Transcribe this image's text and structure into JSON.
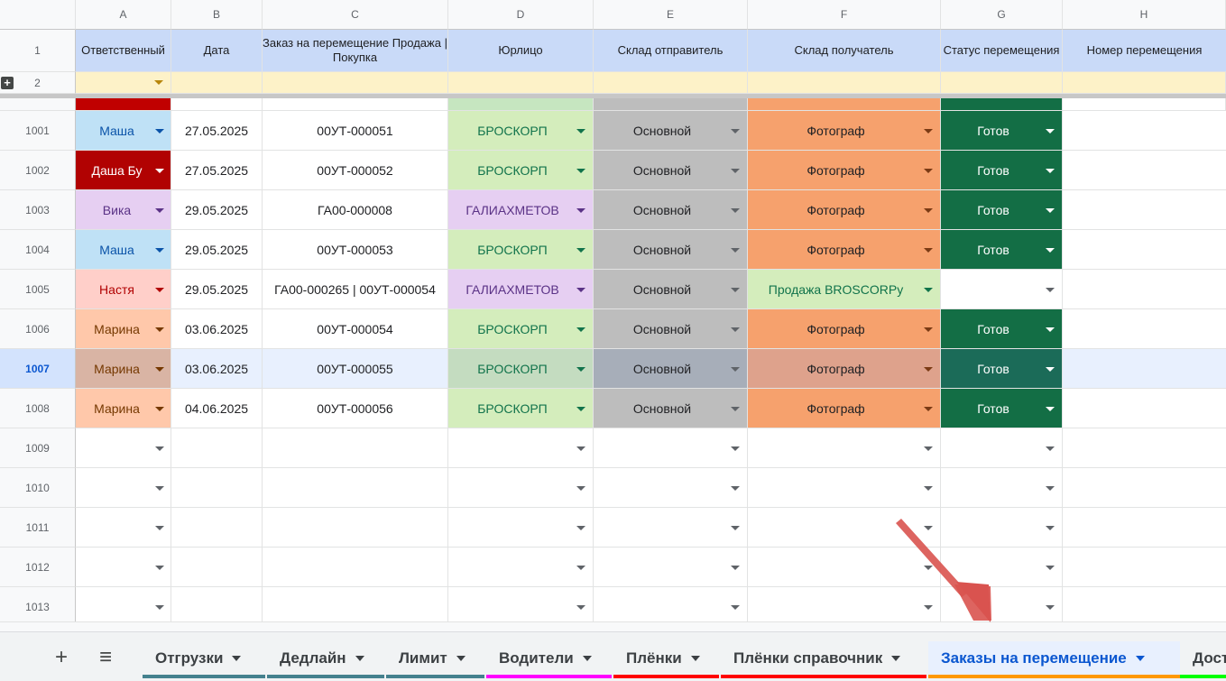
{
  "columns": [
    "A",
    "B",
    "C",
    "D",
    "E",
    "F",
    "G",
    "H"
  ],
  "header_row_num": "1",
  "filter_row_num": "2",
  "headers": {
    "a": "Ответственный",
    "b": "Дата",
    "c": "Заказ на перемещение Продажа |Покупка",
    "d": "Юрлицо",
    "e": "Склад отправитель",
    "f": "Склад получатель",
    "g": "Статус перемещения",
    "h": "Номер перемещения"
  },
  "colors": {
    "header_bg": "#c9daf8",
    "filter_bg": "#fdf2c8",
    "selected_row": "#e8f0fe",
    "active_tab": "#0b57d0"
  },
  "rows": [
    {
      "num": "1001",
      "a": "Маша",
      "b": "27.05.2025",
      "c": "00УТ-000051",
      "d": "БРОСКОРП",
      "e": "Основной",
      "f": "Фотограф",
      "g": "Готов"
    },
    {
      "num": "1002",
      "a": "Даша Бу",
      "b": "27.05.2025",
      "c": "00УТ-000052",
      "d": "БРОСКОРП",
      "e": "Основной",
      "f": "Фотограф",
      "g": "Готов"
    },
    {
      "num": "1003",
      "a": "Вика",
      "b": "29.05.2025",
      "c": "ГА00-000008",
      "d": "ГАЛИАХМЕТОВ",
      "e": "Основной",
      "f": "Фотограф",
      "g": "Готов"
    },
    {
      "num": "1004",
      "a": "Маша",
      "b": "29.05.2025",
      "c": "00УТ-000053",
      "d": "БРОСКОРП",
      "e": "Основной",
      "f": "Фотограф",
      "g": "Готов"
    },
    {
      "num": "1005",
      "a": "Настя",
      "b": "29.05.2025",
      "c": "ГА00-000265 | 00УТ-000054",
      "d": "ГАЛИАХМЕТОВ",
      "e": "Основной",
      "f": "Продажа BROSCORPу",
      "g": ""
    },
    {
      "num": "1006",
      "a": "Марина",
      "b": "03.06.2025",
      "c": "00УТ-000054",
      "d": "БРОСКОРП",
      "e": "Основной",
      "f": "Фотограф",
      "g": "Готов"
    },
    {
      "num": "1007",
      "a": "Марина",
      "b": "03.06.2025",
      "c": "00УТ-000055",
      "d": "БРОСКОРП",
      "e": "Основной",
      "f": "Фотограф",
      "g": "Готов"
    },
    {
      "num": "1008",
      "a": "Марина",
      "b": "04.06.2025",
      "c": "00УТ-000056",
      "d": "БРОСКОРП",
      "e": "Основной",
      "f": "Фотограф",
      "g": "Готов"
    },
    {
      "num": "1009"
    },
    {
      "num": "1010"
    },
    {
      "num": "1011"
    },
    {
      "num": "1012"
    },
    {
      "num": "1013"
    }
  ],
  "tabs": [
    {
      "label": "Отгрузки",
      "color": "#45818e"
    },
    {
      "label": "Дедлайн",
      "color": "#45818e"
    },
    {
      "label": "Лимит",
      "color": "#45818e"
    },
    {
      "label": "Водители",
      "color": "#ff00ff"
    },
    {
      "label": "Плёнки",
      "color": "#ff0000"
    },
    {
      "label": "Плёнки справочник",
      "color": "#ff0000"
    },
    {
      "label": "Заказы на перемещение",
      "color": "#ff9900"
    },
    {
      "label": "Дост",
      "color": "#00ff00"
    }
  ],
  "icons": {
    "add_sheet": "+",
    "all_sheets": "≡",
    "group_expand": "+"
  }
}
